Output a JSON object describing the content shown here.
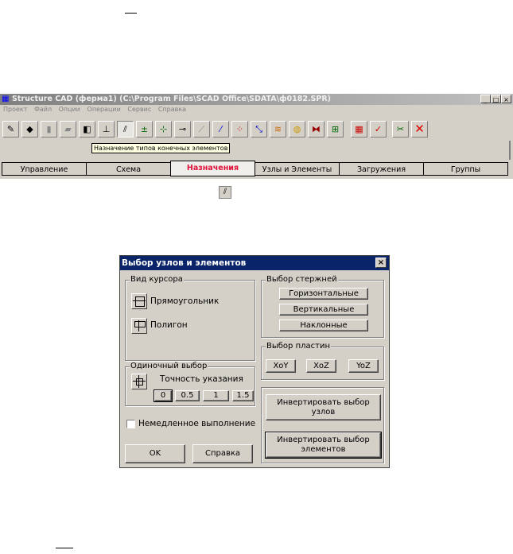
{
  "app": {
    "title": "Structure CAD (ферма1) (C:\\Program Files\\SCAD Office\\SDATA\\ф0182.SPR)",
    "window_buttons": [
      "_",
      "□",
      "×"
    ],
    "menu": [
      "Проект",
      "Файл",
      "Опции",
      "Операции",
      "Сервис",
      "Справка"
    ],
    "tooltip": "Назначение типов конечных элементов",
    "tabs": [
      "Управление",
      "Схема",
      "Назначения",
      "Узлы и Элементы",
      "Загружения",
      "Группы"
    ],
    "active_tab": "Назначения",
    "delete_color": "#e00000"
  },
  "dialog": {
    "title": "Выбор узлов и элементов",
    "close": "×",
    "cursor_group": "Вид курсора",
    "cursor_rect": "Прямоугольник",
    "cursor_polygon": "Полигон",
    "bars_group": "Выбор стержней",
    "bars_horizontal": "Горизонтальные",
    "bars_vertical": "Вертикальные",
    "bars_inclined": "Наклонные",
    "plates_group": "Выбор пластин",
    "plates_xoy": "XoY",
    "plates_xoz": "XoZ",
    "plates_yoz": "YoZ",
    "single_group": "Одиночный выбор",
    "precision_label": "Точность указания",
    "precision_values": [
      "0",
      "0.5",
      "1",
      "1.5"
    ],
    "invert_nodes": "Инвертировать выбор узлов",
    "invert_elements": "Инвертировать выбор элементов",
    "immediate": "Немедленное выполнение",
    "ok": "OK",
    "help": "Справка"
  }
}
